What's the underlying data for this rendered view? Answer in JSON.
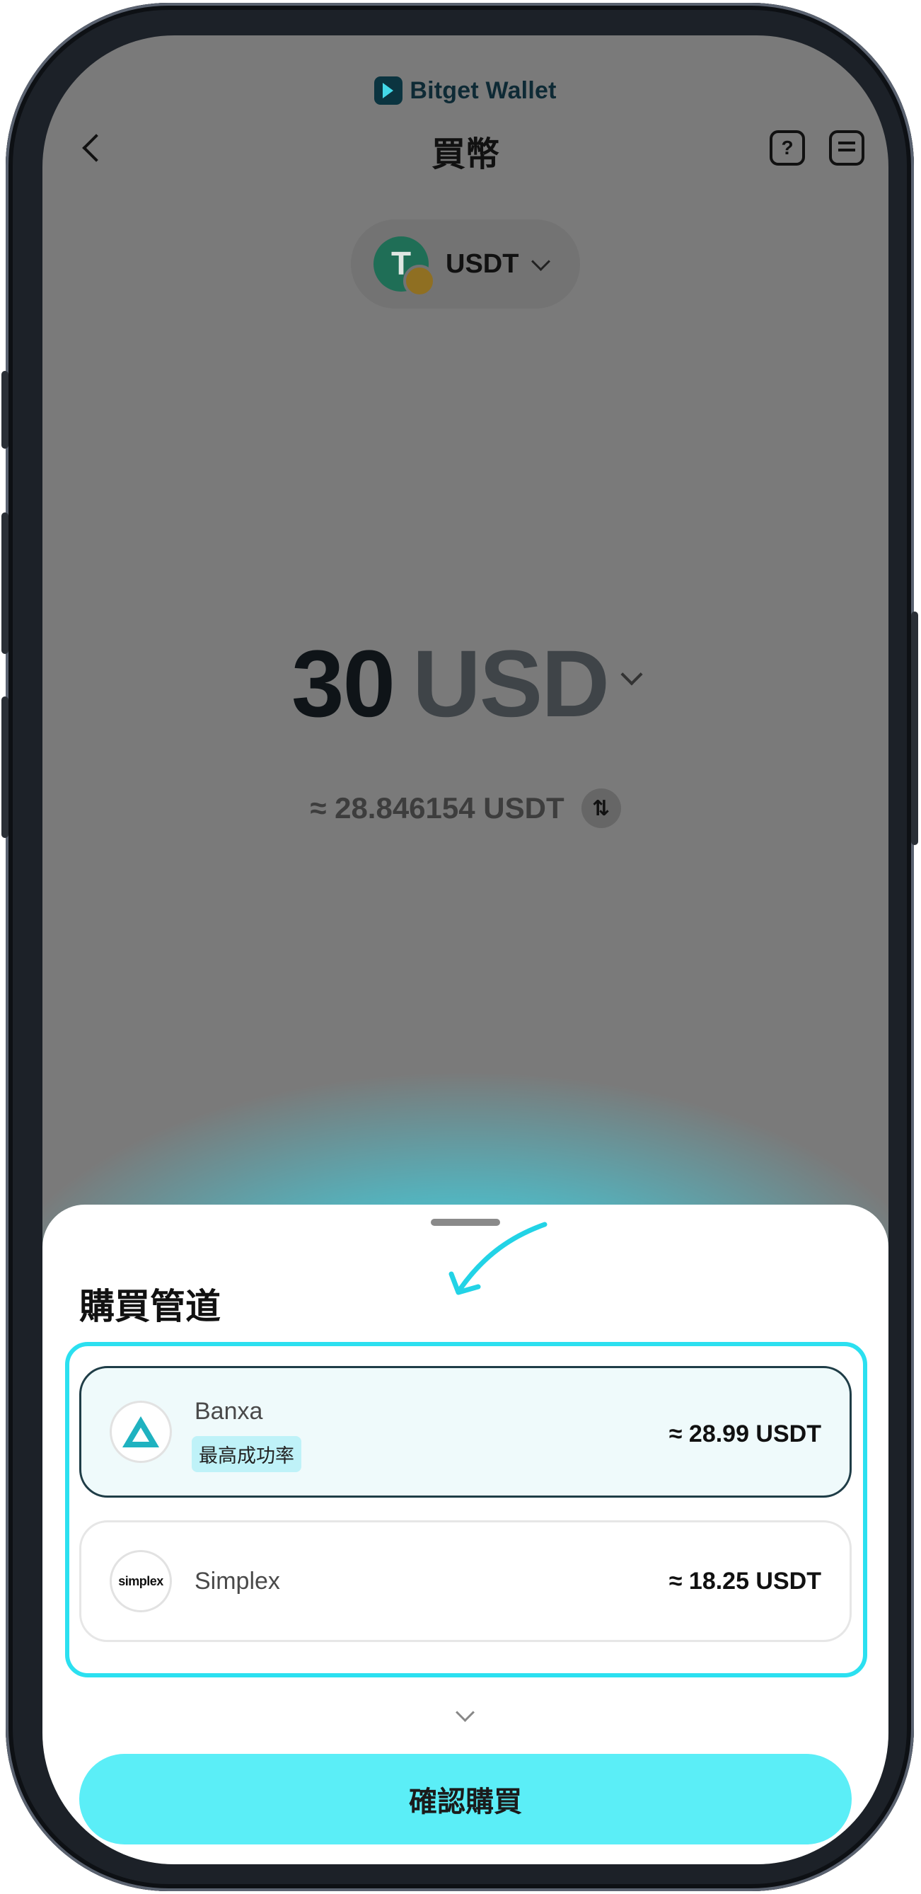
{
  "brand": {
    "name": "Bitget Wallet"
  },
  "header": {
    "title": "買幣",
    "help_icon_text": "?"
  },
  "token": {
    "symbol": "USDT"
  },
  "amount": {
    "value": "30",
    "currency": "USD",
    "approx": "≈ 28.846154 USDT",
    "swap_icon": "⇅"
  },
  "sheet": {
    "title": "購買管道",
    "providers": [
      {
        "name": "Banxa",
        "tag": "最高成功率",
        "quote": "≈ 28.99 USDT",
        "logo": "banxa-triangle"
      },
      {
        "name": "Simplex",
        "logo_text": "simplex",
        "quote": "≈ 18.25 USDT"
      }
    ],
    "confirm_label": "確認購買"
  },
  "colors": {
    "accent": "#5beef7",
    "highlight": "#2be0f0",
    "overlay": "#7a7a7a",
    "brand_dark": "#0b3440"
  }
}
